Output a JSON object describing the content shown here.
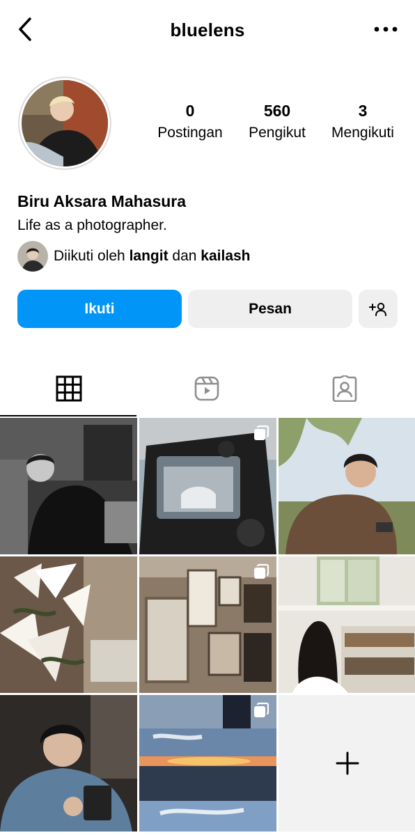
{
  "header": {
    "username": "bluelens",
    "back_icon": "chevron-left-icon",
    "more_icon": "more-horizontal-icon"
  },
  "profile": {
    "full_name": "Biru Aksara Mahasura",
    "bio": "Life as a photographer.",
    "stats": [
      {
        "value": "0",
        "label": "Postingan"
      },
      {
        "value": "560",
        "label": "Pengikut"
      },
      {
        "value": "3",
        "label": "Mengikuti"
      }
    ],
    "followed_by": {
      "prefix": "Diikuti oleh",
      "user1": "langit",
      "conj": "dan",
      "user2": "kailash"
    }
  },
  "actions": {
    "follow_label": "Ikuti",
    "message_label": "Pesan",
    "add_person_icon": "add-person-icon",
    "follow_color": "#0095f6"
  },
  "tabs": [
    {
      "name": "grid",
      "icon": "grid-icon",
      "active": true
    },
    {
      "name": "reels",
      "icon": "reels-icon",
      "active": false
    },
    {
      "name": "tagged",
      "icon": "tagged-person-icon",
      "active": false
    }
  ],
  "posts": [
    {
      "subject": "monochrome portrait",
      "multi": false
    },
    {
      "subject": "camera screen",
      "multi": true
    },
    {
      "subject": "park phone",
      "multi": false
    },
    {
      "subject": "white lilies",
      "multi": false
    },
    {
      "subject": "home decor frames",
      "multi": true
    },
    {
      "subject": "bookshelf reading",
      "multi": false
    },
    {
      "subject": "denim jacket phone",
      "multi": false
    },
    {
      "subject": "sunset sky",
      "multi": true
    }
  ],
  "add_tile_icon": "plus-icon"
}
